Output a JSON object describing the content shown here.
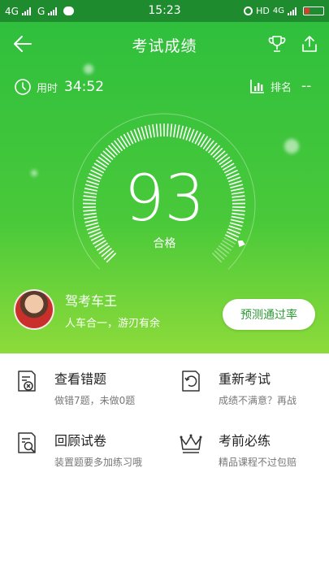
{
  "status_bar": {
    "left_signal_1": "4G",
    "left_signal_2": "G",
    "time": "15:23",
    "right_hd": "HD",
    "right_net": "4G"
  },
  "header": {
    "title": "考试成绩",
    "back_icon": "arrow-left-icon",
    "trophy_icon": "trophy-icon",
    "share_icon": "share-icon"
  },
  "stats": {
    "time_label": "用时",
    "time_value": "34:52",
    "rank_label": "排名",
    "rank_value": "--"
  },
  "result": {
    "score": "93",
    "status": "合格"
  },
  "user": {
    "name": "驾考车王",
    "motto": "人车合一，游刃有余"
  },
  "predict_button": "预测通过率",
  "actions": [
    {
      "title": "查看错题",
      "subtitle": "做错7题，未做0题",
      "icon": "wrong-questions-icon"
    },
    {
      "title": "重新考试",
      "subtitle": "成绩不满意？再战",
      "icon": "retake-exam-icon"
    },
    {
      "title": "回顾试卷",
      "subtitle": "装置题要多加练习哦",
      "icon": "review-paper-icon"
    },
    {
      "title": "考前必练",
      "subtitle": "精品课程不过包赔",
      "icon": "crown-icon"
    }
  ],
  "colors": {
    "status_bar": "#1f8b2f",
    "hero_top": "#2fbf3d",
    "hero_bottom": "#8ddb3a",
    "accent": "#2a9a33"
  }
}
